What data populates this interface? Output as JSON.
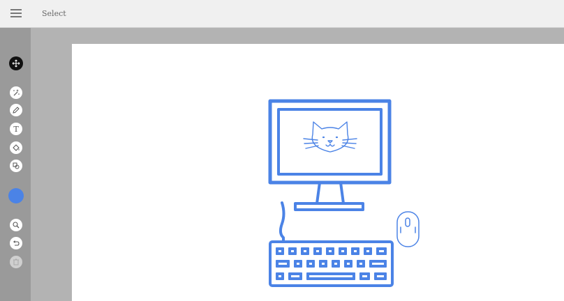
{
  "header": {
    "mode_label": "Select"
  },
  "toolbar": {
    "tools": [
      {
        "name": "move",
        "icon": "move-arrows-icon"
      },
      {
        "name": "magic-wand",
        "icon": "magic-wand-icon"
      },
      {
        "name": "pen",
        "icon": "pen-icon"
      },
      {
        "name": "text",
        "icon": "text-icon",
        "glyph": "T"
      },
      {
        "name": "fill",
        "icon": "fill-bucket-icon"
      },
      {
        "name": "shapes",
        "icon": "shapes-icon"
      },
      {
        "name": "color",
        "icon": "color-swatch",
        "color": "#4b83e6"
      },
      {
        "name": "zoom",
        "icon": "zoom-icon"
      },
      {
        "name": "undo",
        "icon": "undo-icon"
      },
      {
        "name": "delete",
        "icon": "trash-icon",
        "disabled": true
      }
    ]
  },
  "canvas": {
    "illustration": "desktop-computer-with-cat",
    "stroke_color": "#4b83e6",
    "background": "#ffffff"
  }
}
